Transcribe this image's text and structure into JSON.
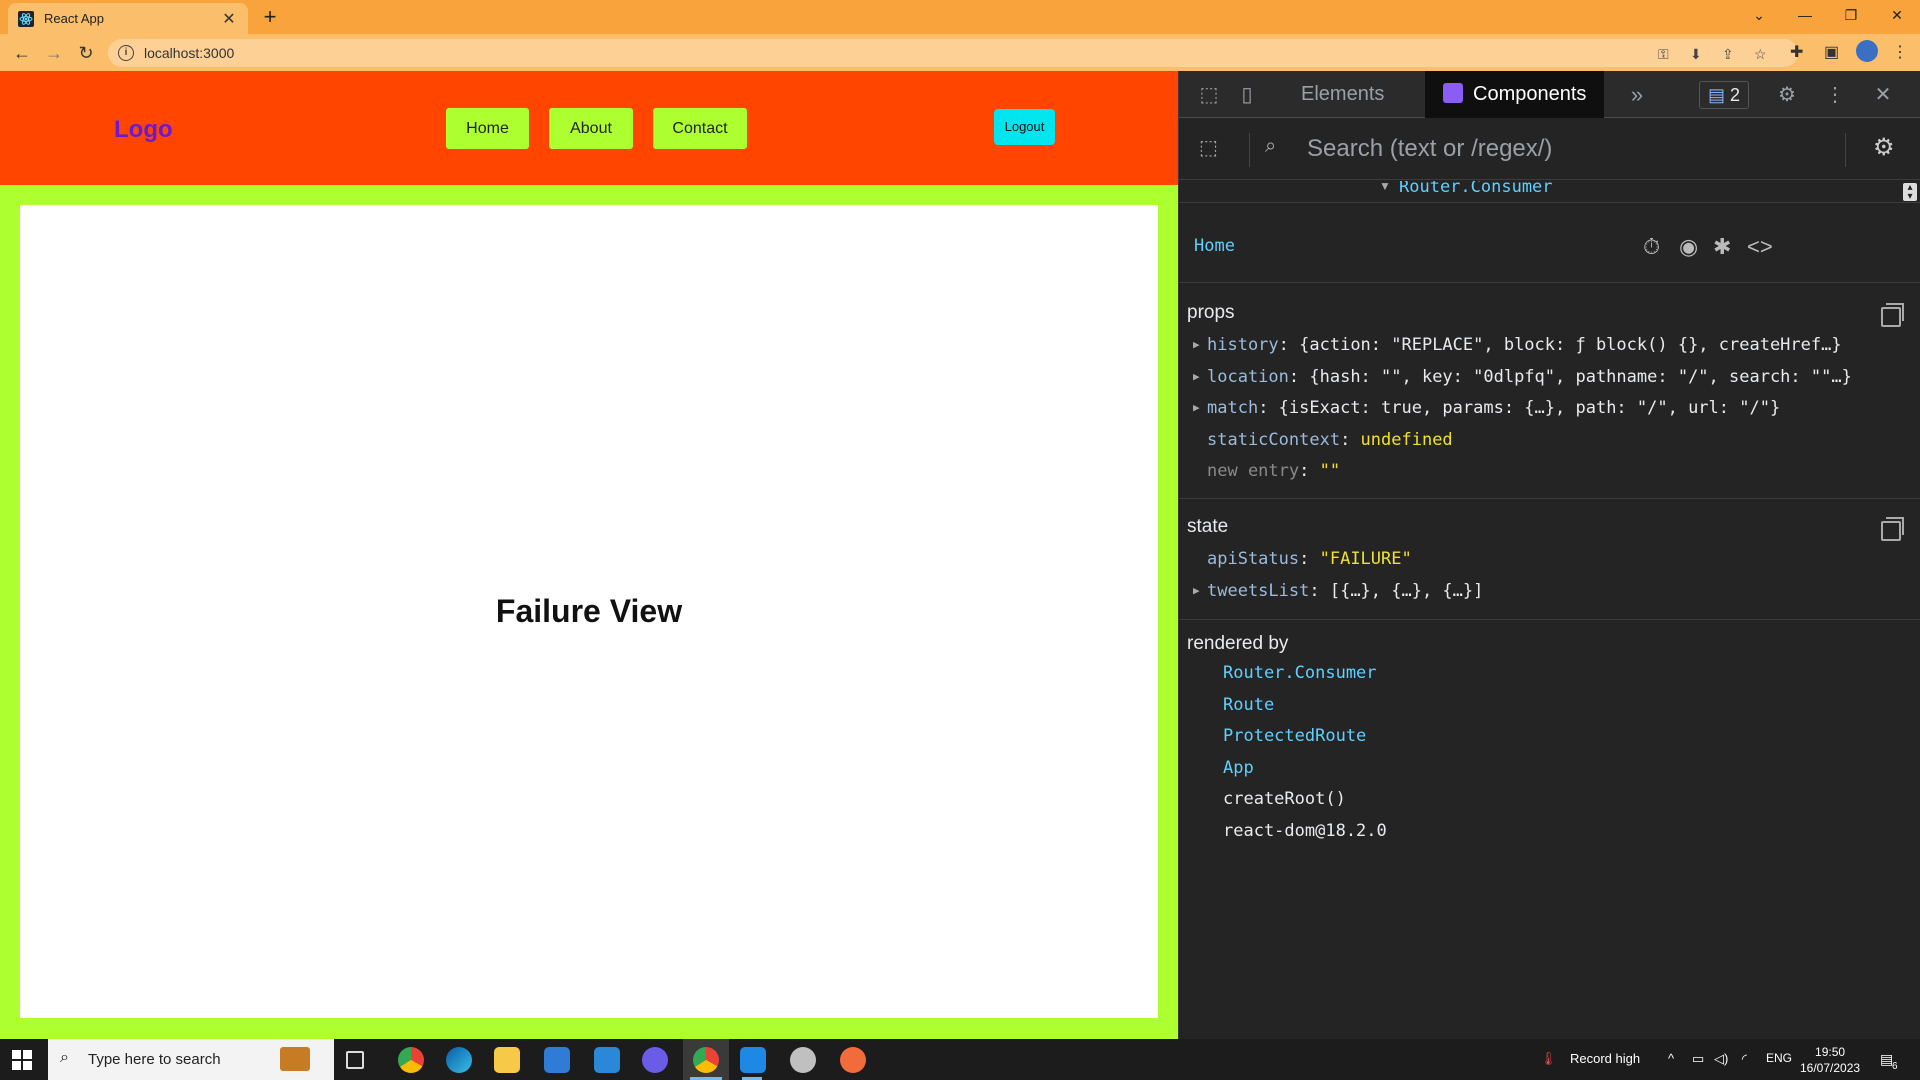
{
  "browser": {
    "tab_title": "React App",
    "tab_close": "✕",
    "new_tab": "+",
    "url": "localhost:3000"
  },
  "app": {
    "logo": "Logo",
    "nav": [
      "Home",
      "About",
      "Contact"
    ],
    "logout": "Logout",
    "failure_title": "Failure View",
    "colors": {
      "header": "#ff4500",
      "page_bg": "#adff2f",
      "logo": "#6a1bd1",
      "logout": "#00e5ee"
    }
  },
  "devtools": {
    "tabs": {
      "elements": "Elements",
      "components": "Components",
      "more": "»"
    },
    "issues_count": "2",
    "search_placeholder": "Search (text or /regex/)",
    "tree_node": "Router.Consumer",
    "component_name": "Home",
    "props_title": "props",
    "props": [
      {
        "key": "history",
        "expandable": true,
        "value": "{action: \"REPLACE\", block: ƒ block() {}, createHref…}",
        "yellow": false,
        "dim": false
      },
      {
        "key": "location",
        "expandable": true,
        "value": "{hash: \"\", key: \"0dlpfq\", pathname: \"/\", search: \"\"…}",
        "yellow": false,
        "dim": false
      },
      {
        "key": "match",
        "expandable": true,
        "value": "{isExact: true, params: {…}, path: \"/\", url: \"/\"}",
        "yellow": false,
        "dim": false
      },
      {
        "key": "staticContext",
        "expandable": false,
        "value": "undefined",
        "yellow": true,
        "dim": false
      },
      {
        "key": "new entry",
        "expandable": false,
        "value": "\"\"",
        "yellow": true,
        "dim": true
      }
    ],
    "state_title": "state",
    "state": [
      {
        "key": "apiStatus",
        "expandable": false,
        "value": "\"FAILURE\"",
        "yellow": true,
        "dim": false
      },
      {
        "key": "tweetsList",
        "expandable": true,
        "value": "[{…}, {…}, {…}]",
        "yellow": false,
        "dim": false
      }
    ],
    "rendered_by_title": "rendered by",
    "rendered_by": [
      {
        "label": "Router.Consumer",
        "link": true
      },
      {
        "label": "Route",
        "link": true
      },
      {
        "label": "ProtectedRoute",
        "link": true
      },
      {
        "label": "App",
        "link": true
      },
      {
        "label": "createRoot()",
        "link": false
      },
      {
        "label": "react-dom@18.2.0",
        "link": false
      }
    ]
  },
  "taskbar": {
    "search_placeholder": "Type here to search",
    "weather": "Record high",
    "language": "ENG",
    "time": "19:50",
    "date": "16/07/2023",
    "notifications": "6"
  }
}
